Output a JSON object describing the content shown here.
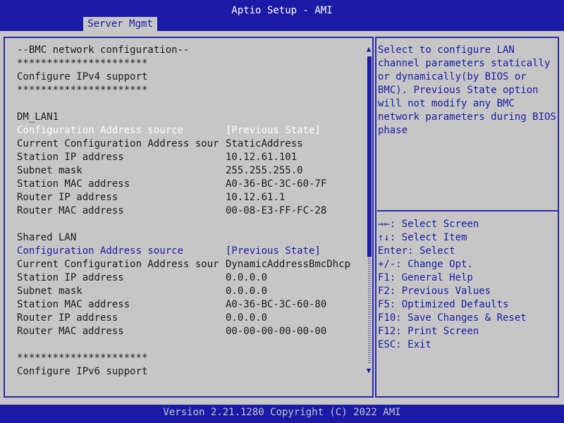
{
  "header": {
    "title": "Aptio Setup - AMI",
    "tab": "Server Mgmt"
  },
  "main": {
    "rows": [
      {
        "label": "--BMC network configuration--",
        "value": ""
      },
      {
        "label": "**********************",
        "value": ""
      },
      {
        "label": "Configure IPv4 support",
        "value": ""
      },
      {
        "label": "**********************",
        "value": ""
      },
      {
        "label": "DM_LAN1",
        "value": ""
      },
      {
        "label": "Configuration Address source",
        "value": "[Previous State]"
      },
      {
        "label": "Current Configuration Address sour",
        "value": "StaticAddress"
      },
      {
        "label": "Station IP address",
        "value": "10.12.61.101"
      },
      {
        "label": "Subnet mask",
        "value": "255.255.255.0"
      },
      {
        "label": "Station MAC address",
        "value": "A0-36-BC-3C-60-7F"
      },
      {
        "label": "Router IP address",
        "value": "10.12.61.1"
      },
      {
        "label": "Router MAC address",
        "value": "00-08-E3-FF-FC-28"
      },
      {
        "label": "Shared LAN",
        "value": ""
      },
      {
        "label": "Configuration Address source",
        "value": "[Previous State]"
      },
      {
        "label": "Current Configuration Address sour",
        "value": "DynamicAddressBmcDhcp"
      },
      {
        "label": "Station IP address",
        "value": "0.0.0.0"
      },
      {
        "label": "Subnet mask",
        "value": "0.0.0.0"
      },
      {
        "label": "Station MAC address",
        "value": "A0-36-BC-3C-60-80"
      },
      {
        "label": "Router IP address",
        "value": "0.0.0.0"
      },
      {
        "label": "Router MAC address",
        "value": "00-00-00-00-00-00"
      },
      {
        "label": "**********************",
        "value": ""
      },
      {
        "label": "Configure IPv6 support",
        "value": ""
      }
    ]
  },
  "help": {
    "lines": [
      "Select to configure LAN",
      "channel parameters statically",
      "or dynamically(by BIOS or",
      "BMC). Previous State option",
      "will not modify any BMC",
      "network parameters during BIOS",
      "phase"
    ]
  },
  "keys": [
    "→←: Select Screen",
    "↑↓: Select Item",
    "Enter: Select",
    "+/-: Change Opt.",
    "F1: General Help",
    "F2: Previous Values",
    "F5: Optimized Defaults",
    "F10: Save Changes & Reset",
    "F12: Print Screen",
    "ESC: Exit"
  ],
  "footer": {
    "text": "Version 2.21.1280 Copyright (C) 2022 AMI"
  },
  "colors": {
    "background": "#1a1aa6",
    "panel": "#c6c6c6",
    "highlight": "#ffffff",
    "text": "#1a1a1a"
  },
  "scroll": {
    "up_icon": "▲",
    "down_icon": "▼"
  }
}
